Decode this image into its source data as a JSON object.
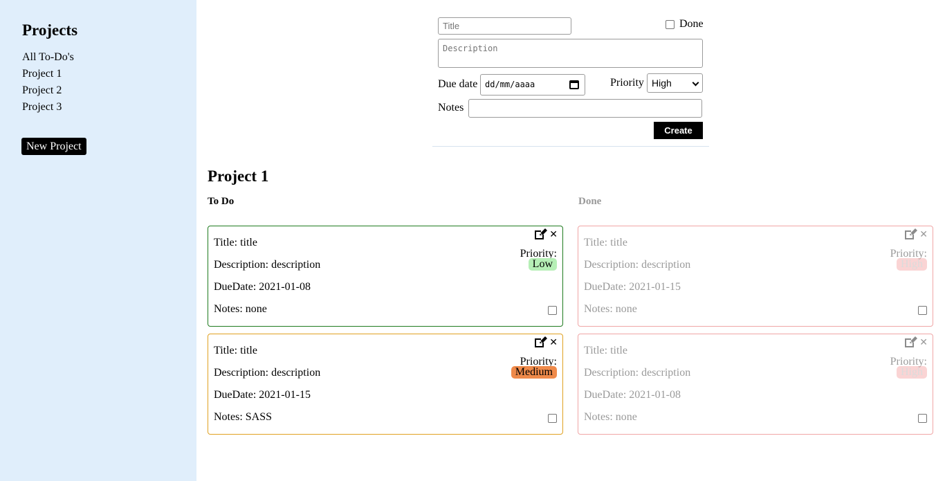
{
  "sidebar": {
    "title": "Projects",
    "projects": [
      "All To-Do's",
      "Project 1",
      "Project 2",
      "Project 3"
    ],
    "new_project_label": "New Project"
  },
  "form": {
    "title_placeholder": "Title",
    "done_label": "Done",
    "description_placeholder": "Description",
    "due_label": "Due date",
    "due_placeholder": "dd/mm/aaaa",
    "priority_label": "Priority",
    "priority_value": "High",
    "notes_label": "Notes",
    "notes_value": "",
    "create_label": "Create"
  },
  "main": {
    "project_title": "Project 1",
    "todo_heading": "To Do",
    "done_heading": "Done",
    "priority_label": "Priority:",
    "cards": [
      {
        "title": "Title: title",
        "description": "Description: description",
        "due": "DueDate: 2021-01-08",
        "notes": "Notes: none",
        "priority": "Low",
        "border": "#1e7a1e",
        "badge_color": "#b6efb6",
        "done": false
      },
      {
        "title": "Title: title",
        "description": "Description: description",
        "due": "DueDate: 2021-01-15",
        "notes": "Notes: none",
        "priority": "High",
        "border": "#f0a6a6",
        "badge_color": "#f18686",
        "done": true
      },
      {
        "title": "Title: title",
        "description": "Description: description",
        "due": "DueDate: 2021-01-15",
        "notes": "Notes: SASS",
        "priority": "Medium",
        "border": "#e0a020",
        "badge_color": "#ef8a4a",
        "done": false
      },
      {
        "title": "Title: title",
        "description": "Description: description",
        "due": "DueDate: 2021-01-08",
        "notes": "Notes: none",
        "priority": "High",
        "border": "#f0a6a6",
        "badge_color": "#f18686",
        "done": true
      }
    ]
  }
}
